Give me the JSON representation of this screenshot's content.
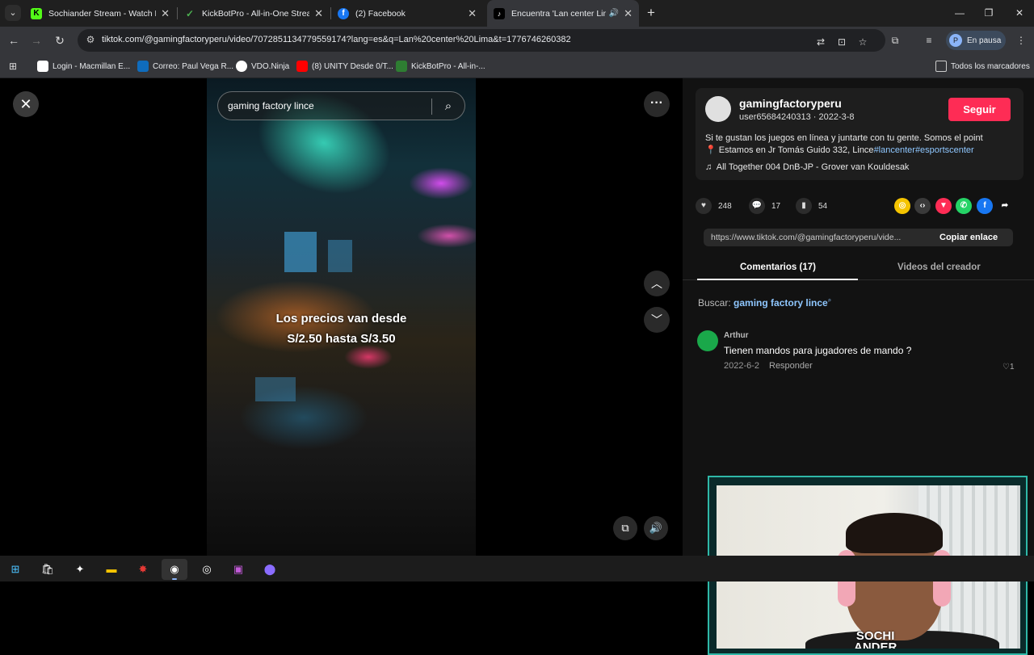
{
  "browser": {
    "tabs": [
      {
        "title": "Sochiander Stream - Watch Liv",
        "favicon_color": "#53fc18",
        "glyph": "K"
      },
      {
        "title": "KickBotPro - All-in-One Stream",
        "favicon_color": "#2e7d32",
        "glyph": "✓"
      },
      {
        "title": "(2) Facebook",
        "favicon_color": "#1877f2",
        "glyph": "f"
      },
      {
        "title": "Encuentra 'Lan center Lima",
        "favicon_color": "#000000",
        "glyph": "♪"
      }
    ],
    "url": "tiktok.com/@gamingfactoryperu/video/7072851134779559174?lang=es&q=Lan%20center%20Lima&t=1776746260382",
    "profile_label": "En pausa",
    "profile_initial": "P",
    "bookmarks": [
      {
        "label": "Login - Macmillan E...",
        "color": "#ffffff"
      },
      {
        "label": "Correo: Paul Vega R...",
        "color": "#0f6cbd"
      },
      {
        "label": "VDO.Ninja",
        "color": "#ffffff"
      },
      {
        "label": "(8) UNITY Desde 0/T...",
        "color": "#ff0000"
      },
      {
        "label": "KickBotPro - All-in-...",
        "color": "#2e7d32"
      }
    ],
    "all_bookmarks": "Todos los marcadores"
  },
  "video": {
    "search_query": "gaming factory lince",
    "caption_line1": "Los precios van desde",
    "caption_line2": "S/2.50 hasta S/3.50"
  },
  "post": {
    "username": "gamingfactoryperu",
    "subline": "user65684240313 · 2022-3-8",
    "follow_label": "Seguir",
    "description": "Si te gustan los juegos en línea y juntarte con tu gente. Somos el point",
    "location_prefix": "Estamos en Jr Tomás Guido 332, Lince",
    "tag1": "#lancenter",
    "tag2": "#esportscenter",
    "music": "All Together 004 DnB-JP - Grover van Kouldesak",
    "likes": "248",
    "comments": "17",
    "saves": "54",
    "link": "https://www.tiktok.com/@gamingfactoryperu/vide...",
    "copy_label": "Copiar enlace"
  },
  "panel_tabs": {
    "comments": "Comentarios (17)",
    "creator_videos": "Videos del creador"
  },
  "search_suggest": {
    "prefix": "Buscar:",
    "query": "gaming factory lince"
  },
  "comment": {
    "author": "Arthur",
    "text": "Tienen mandos para jugadores de mando ?",
    "date": "2022-6-2",
    "reply_label": "Responder",
    "likes": "1"
  },
  "webcam": {
    "logo_line1": "SOCHI",
    "logo_line2": "ANDER"
  },
  "colors": {
    "accent": "#fe2c55",
    "link": "#8fc7ff",
    "webcam_border": "#2fb8a8"
  }
}
